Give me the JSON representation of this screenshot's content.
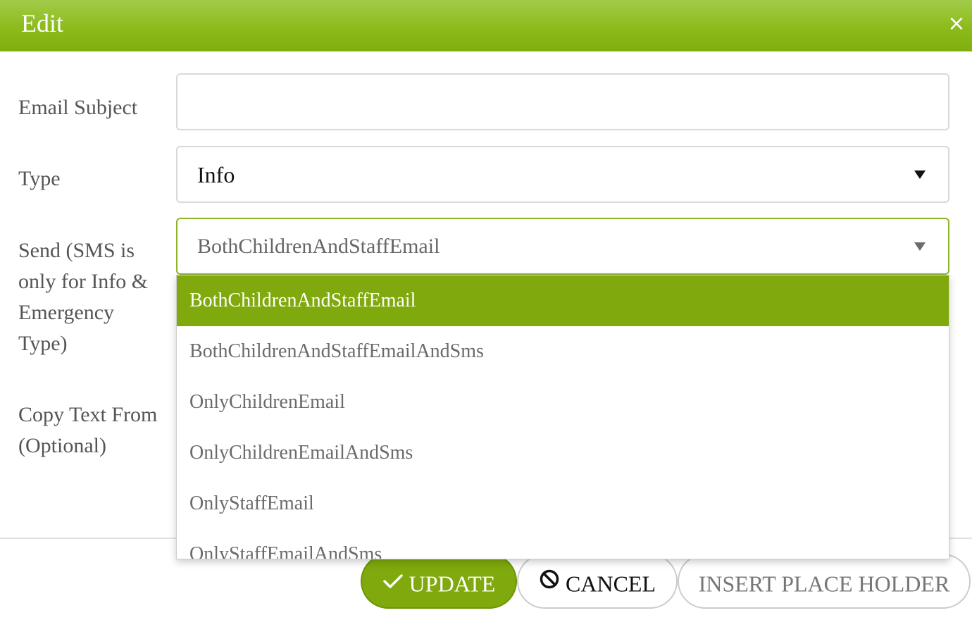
{
  "dialog": {
    "title": "Edit",
    "close_symbol": "×"
  },
  "form": {
    "email_subject": {
      "label": "Email Subject",
      "value": "",
      "placeholder": ""
    },
    "type": {
      "label": "Type",
      "selected": "Info"
    },
    "send": {
      "label": "Send (SMS is only for Info & Emergency Type)",
      "selected": "BothChildrenAndStaffEmail",
      "options": [
        "BothChildrenAndStaffEmail",
        "BothChildrenAndStaffEmailAndSms",
        "OnlyChildrenEmail",
        "OnlyChildrenEmailAndSms",
        "OnlyStaffEmail",
        "OnlyStaffEmailAndSms"
      ],
      "highlighted_index": 0
    },
    "copy_text_from": {
      "label": "Copy Text From (Optional)"
    }
  },
  "buttons": {
    "update_label": "UPDATE",
    "update_icon": "check-icon",
    "cancel_label": "CANCEL",
    "cancel_icon": "ban-icon",
    "insert_label": "INSERT PLACE HOLDER"
  },
  "colors": {
    "accent": "#7fa90c",
    "header_gradient_top": "#a2cb49",
    "header_gradient_bottom": "#7fae0e",
    "focus_border": "#8db52a"
  }
}
